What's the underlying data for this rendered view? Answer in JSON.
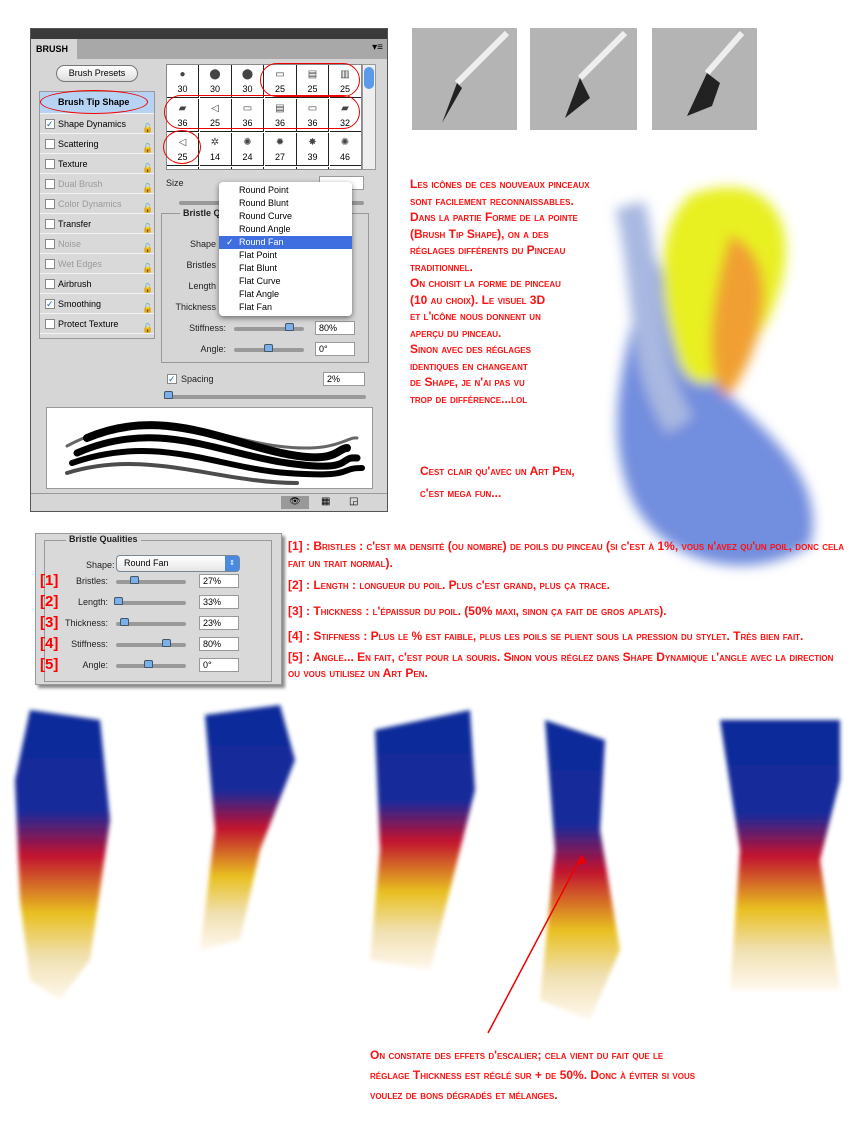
{
  "panel": {
    "tab": "BRUSH",
    "presets_button": "Brush Presets",
    "items": [
      {
        "label": "Brush Tip Shape",
        "checked": null,
        "enabled": true
      },
      {
        "label": "Shape Dynamics",
        "checked": true,
        "enabled": true
      },
      {
        "label": "Scattering",
        "checked": false,
        "enabled": true
      },
      {
        "label": "Texture",
        "checked": false,
        "enabled": true
      },
      {
        "label": "Dual Brush",
        "checked": false,
        "enabled": false
      },
      {
        "label": "Color Dynamics",
        "checked": false,
        "enabled": false
      },
      {
        "label": "Transfer",
        "checked": false,
        "enabled": true
      },
      {
        "label": "Noise",
        "checked": false,
        "enabled": false
      },
      {
        "label": "Wet Edges",
        "checked": false,
        "enabled": false
      },
      {
        "label": "Airbrush",
        "checked": false,
        "enabled": true
      },
      {
        "label": "Smoothing",
        "checked": true,
        "enabled": true
      },
      {
        "label": "Protect Texture",
        "checked": false,
        "enabled": true
      }
    ],
    "brush_sizes": [
      "30",
      "30",
      "30",
      "25",
      "25",
      "25",
      "36",
      "25",
      "36",
      "36",
      "36",
      "32",
      "25",
      "14",
      "24",
      "27",
      "39",
      "46"
    ],
    "size_label": "Size",
    "group_title": "Bristle Q",
    "labels": {
      "shape": "Shape",
      "bristles": "Bristles",
      "length": "Length",
      "thickness": "Thickness",
      "stiffness": "Stiffness:",
      "angle": "Angle:"
    },
    "stiffness": "80%",
    "angle": "0°",
    "spacing_label": "Spacing",
    "spacing": "2%",
    "menu": [
      "Round Point",
      "Round Blunt",
      "Round Curve",
      "Round Angle",
      "Round Fan",
      "Flat Point",
      "Flat Blunt",
      "Flat Curve",
      "Flat Angle",
      "Flat Fan"
    ],
    "menu_selected": "Round Fan",
    "check": "✓"
  },
  "bristle_panel": {
    "title": "Bristle Qualities",
    "shape_label": "Shape:",
    "shape_value": "Round Fan",
    "rows": [
      {
        "num": "[1]",
        "label": "Bristles:",
        "value": "27%",
        "pos": 0.27
      },
      {
        "num": "[2]",
        "label": "Length:",
        "value": "33%",
        "pos": 0.0
      },
      {
        "num": "[3]",
        "label": "Thickness:",
        "value": "23%",
        "pos": 0.1
      },
      {
        "num": "[4]",
        "label": "Stiffness:",
        "value": "80%",
        "pos": 0.8
      },
      {
        "num": "[5]",
        "label": "Angle:",
        "value": "0°",
        "pos": 0.5
      }
    ]
  },
  "notes": {
    "intro": [
      "Les  icônes de ces nouveaux pinceaux",
      "sont facilement reconnaissables.",
      "Dans la partie Forme de la pointe",
      "(Brush Tip Shape), on a des",
      "réglages différents du Pinceau",
      "traditionnel.",
      "On choisit la forme de pinceau",
      "(10 au choix). Le visuel 3D",
      "et l'icône nous donnent un",
      "aperçu du pinceau.",
      "Sinon avec des réglages",
      "identiques en changeant",
      "de Shape, je n'ai pas vu",
      "trop de différence...lol"
    ],
    "artpen": [
      "Cest clair qu'avec un Art Pen,",
      "c'est mega fun..."
    ],
    "explain": [
      "[1] : Bristles : c'est ma densité (ou nombre) de poils du pinceau (si c'est à 1%, vous n'avez qu'un poil, donc cela fait un trait normal).",
      "[2] : Length : longueur du poil. Plus c'est grand, plus ça trace.",
      "[3] : Thickness : l'épaissur du poil. (50% maxi, sinon ça fait de gros aplats).",
      "[4] : Stiffness : Plus le % est faible, plus les poils se plient sous la pression du stylet. Très bien fait.",
      "[5] : Angle... En fait, c'est pour la souris. Sinon  vous réglez dans Shape Dynamique l'angle avec la direction ou vous utilisez un Art Pen."
    ],
    "bottom": [
      "On constate des effets d'escalier; cela vient du fait que le",
      "réglage Thickness est réglé sur + de 50%. Donc à éviter si vous",
      "voulez de bons dégradés et mélanges."
    ]
  },
  "colors": {
    "annotation": "#ff1010",
    "selection": "#3f6ee0",
    "paint_blue": "#0a2a9a",
    "paint_red": "#d01020",
    "paint_yellow": "#e8c020"
  }
}
